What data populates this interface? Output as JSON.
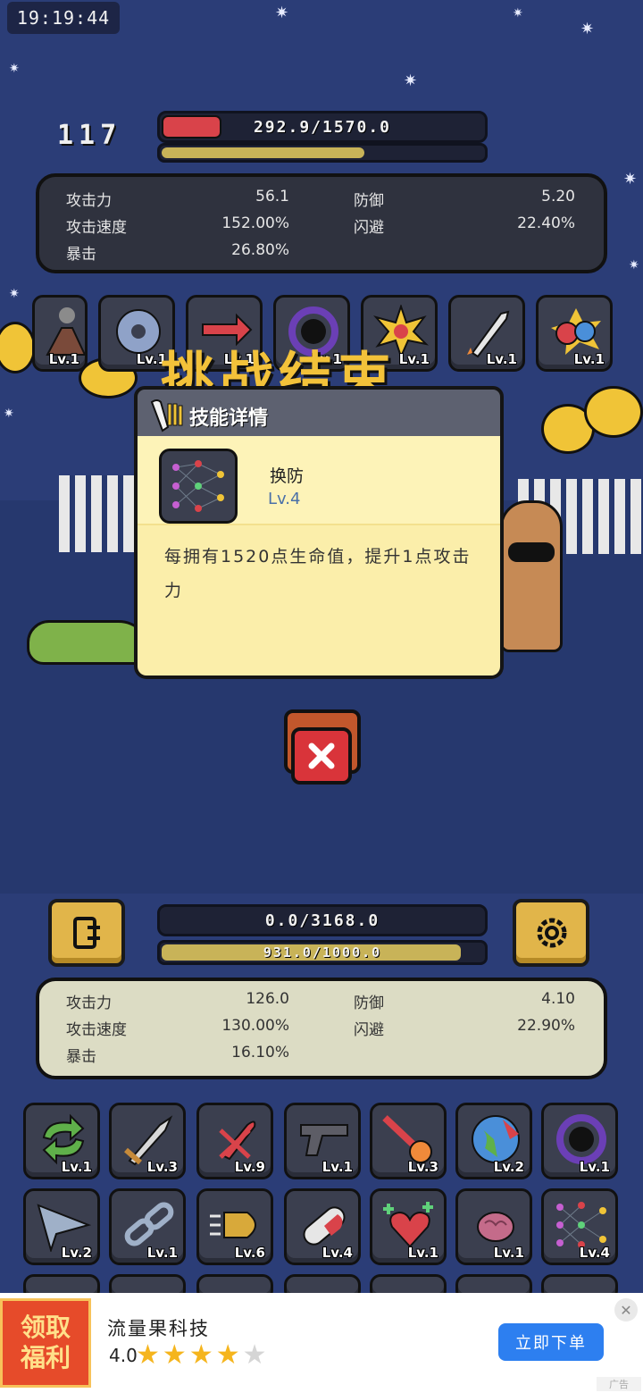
{
  "status": {
    "clock": "19:19:44"
  },
  "enemy": {
    "wave": "117",
    "hp_text": "292.9/1570.0",
    "hp_fraction": 0.187,
    "secondary_fraction": 0.63,
    "stats": {
      "attack_label": "攻击力",
      "attack_value": "56.1",
      "defense_label": "防御",
      "defense_value": "5.20",
      "speed_label": "攻击速度",
      "speed_value": "152.00%",
      "dodge_label": "闪避",
      "dodge_value": "22.40%",
      "crit_label": "暴击",
      "crit_value": "26.80%"
    },
    "skills": [
      {
        "icon": "volcano-icon",
        "level": "Lv.1"
      },
      {
        "icon": "saw-blade-icon",
        "level": "Lv.1"
      },
      {
        "icon": "arrows-icon",
        "level": "Lv.1"
      },
      {
        "icon": "black-hole-icon",
        "level": "Lv.1"
      },
      {
        "icon": "explosion-icon",
        "level": "Lv.1"
      },
      {
        "icon": "rocket-icon",
        "level": "Lv.1"
      },
      {
        "icon": "boxing-gloves-icon",
        "level": "Lv.1"
      }
    ]
  },
  "banner_text": "挑战结束",
  "modal": {
    "title": "技能详情",
    "skill_name": "换防",
    "skill_level": "Lv.4",
    "description": "每拥有1520点生命值，提升1点攻击力"
  },
  "player": {
    "hp_text": "0.0/3168.0",
    "hp_fraction": 0.0,
    "exp_text": "931.0/1000.0",
    "exp_fraction": 0.931,
    "stats": {
      "attack_label": "攻击力",
      "attack_value": "126.0",
      "defense_label": "防御",
      "defense_value": "4.10",
      "speed_label": "攻击速度",
      "speed_value": "130.00%",
      "dodge_label": "闪避",
      "dodge_value": "22.90%",
      "crit_label": "暴击",
      "crit_value": "16.10%"
    },
    "skills_row1": [
      {
        "icon": "cycle-arrows-icon",
        "level": "Lv.1"
      },
      {
        "icon": "sword-icon",
        "level": "Lv.3"
      },
      {
        "icon": "crossed-bullet-icon",
        "level": "Lv.9"
      },
      {
        "icon": "pistol-icon",
        "level": "Lv.1"
      },
      {
        "icon": "meteor-icon",
        "level": "Lv.3"
      },
      {
        "icon": "globe-icon",
        "level": "Lv.2"
      },
      {
        "icon": "black-hole-icon",
        "level": "Lv.1"
      }
    ],
    "skills_row2": [
      {
        "icon": "paper-plane-icon",
        "level": "Lv.2"
      },
      {
        "icon": "chain-link-icon",
        "level": "Lv.1"
      },
      {
        "icon": "bullet-icon",
        "level": "Lv.6"
      },
      {
        "icon": "pill-icon",
        "level": "Lv.4"
      },
      {
        "icon": "heart-plus-icon",
        "level": "Lv.1"
      },
      {
        "icon": "brain-icon",
        "level": "Lv.1"
      },
      {
        "icon": "neural-net-icon",
        "level": "Lv.4"
      }
    ]
  },
  "ad": {
    "badge_line1": "领取",
    "badge_line2": "福利",
    "app_name": "流量果科技",
    "rating": "4.0",
    "rating_value": 4,
    "cta": "立即下单",
    "tag": "广告"
  }
}
